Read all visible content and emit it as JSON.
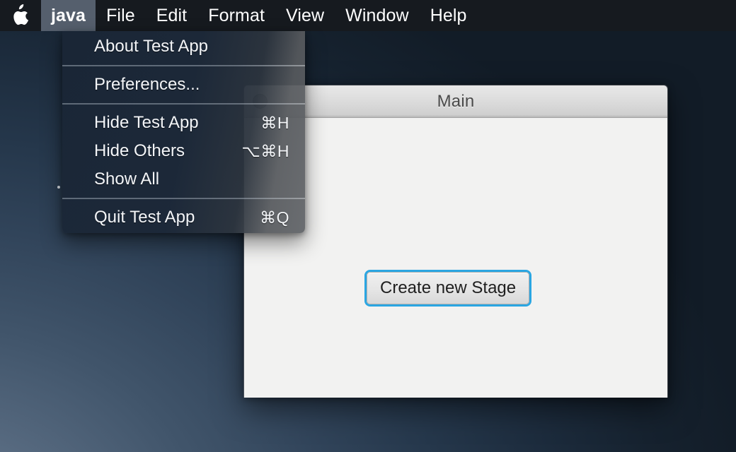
{
  "menubar": {
    "apple_icon": "apple-logo-icon",
    "items": [
      {
        "label": "java",
        "active": true
      },
      {
        "label": "File",
        "active": false
      },
      {
        "label": "Edit",
        "active": false
      },
      {
        "label": "Format",
        "active": false
      },
      {
        "label": "View",
        "active": false
      },
      {
        "label": "Window",
        "active": false
      },
      {
        "label": "Help",
        "active": false
      }
    ]
  },
  "dropdown": {
    "owner": "java",
    "groups": [
      {
        "items": [
          {
            "label": "About Test App",
            "shortcut": ""
          }
        ]
      },
      {
        "items": [
          {
            "label": "Preferences...",
            "shortcut": ""
          }
        ]
      },
      {
        "items": [
          {
            "label": "Hide Test App",
            "shortcut": "⌘H"
          },
          {
            "label": "Hide Others",
            "shortcut": "⌥⌘H"
          },
          {
            "label": "Show All",
            "shortcut": ""
          }
        ]
      },
      {
        "items": [
          {
            "label": "Quit Test App",
            "shortcut": "⌘Q"
          }
        ]
      }
    ]
  },
  "window": {
    "title": "Main",
    "close_button": "close-button-inactive",
    "content": {
      "button_label": "Create new Stage"
    }
  },
  "colors": {
    "menubar_bg": "#161a1f",
    "menu_highlight": "#555f6d",
    "desktop_light": "#6f8296",
    "desktop_dark": "#121c27",
    "titlebar_top": "#e8e8e8",
    "titlebar_bottom": "#b6b6b6",
    "window_content": "#f2f2f1",
    "focus_ring": "#2ba6e2",
    "menu_text": "#f3f5f8"
  }
}
